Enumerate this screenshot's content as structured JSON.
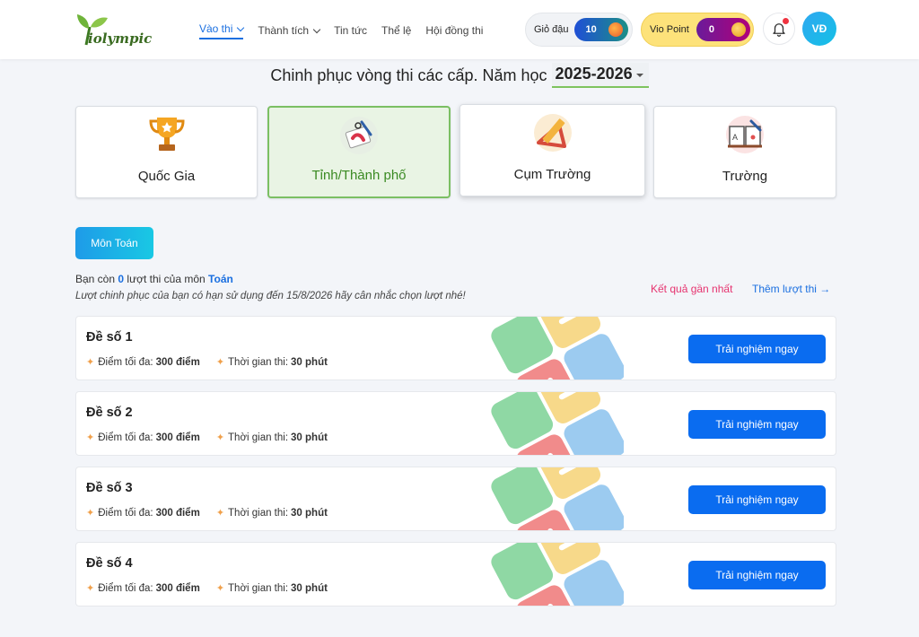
{
  "logo": {
    "text": "iolympic"
  },
  "nav": [
    {
      "label": "Vào thi",
      "dropdown": true,
      "active": true
    },
    {
      "label": "Thành tích",
      "dropdown": true
    },
    {
      "label": "Tin tức"
    },
    {
      "label": "Thể lệ"
    },
    {
      "label": "Hội đồng thi"
    }
  ],
  "gio_dau": {
    "label": "Giỏ đậu",
    "value": "10"
  },
  "vio_point": {
    "label": "Vio Point",
    "value": "0"
  },
  "user": {
    "initials": "VĐ"
  },
  "heading": {
    "text": "Chinh phục vòng thi các cấp. Năm học",
    "year": "2025-2026"
  },
  "levels": [
    {
      "label": "Quốc Gia",
      "icon": "trophy-icon"
    },
    {
      "label": "Tỉnh/Thành phố",
      "icon": "map-pen-icon",
      "selected": true
    },
    {
      "label": "Cụm Trường",
      "icon": "ruler-triangle-icon"
    },
    {
      "label": "Trường",
      "icon": "book-icon"
    }
  ],
  "subject_button": "Môn Toán",
  "remaining": {
    "prefix": "Bạn còn",
    "count": "0",
    "middle": "lượt thi của môn",
    "subject": "Toán"
  },
  "notice": "Lượt chinh phục của bạn có hạn sử dụng đến 15/8/2026 hãy cân nhắc chọn lượt nhé!",
  "links": {
    "latest_result": "Kết quả gần nhất",
    "add_turns": "Thêm lượt thi →"
  },
  "exams": [
    {
      "name": "Đề số 1",
      "max_label": "Điểm tối đa:",
      "max_value": "300 điểm",
      "time_label": "Thời gian thi:",
      "time_value": "30 phút",
      "button": "Trải nghiệm ngay"
    },
    {
      "name": "Đề số 2",
      "max_label": "Điểm tối đa:",
      "max_value": "300 điểm",
      "time_label": "Thời gian thi:",
      "time_value": "30 phút",
      "button": "Trải nghiệm ngay"
    },
    {
      "name": "Đề số 3",
      "max_label": "Điểm tối đa:",
      "max_value": "300 điểm",
      "time_label": "Thời gian thi:",
      "time_value": "30 phút",
      "button": "Trải nghiệm ngay"
    },
    {
      "name": "Đề số 4",
      "max_label": "Điểm tối đa:",
      "max_value": "300 điểm",
      "time_label": "Thời gian thi:",
      "time_value": "30 phút",
      "button": "Trải nghiệm ngay"
    }
  ]
}
